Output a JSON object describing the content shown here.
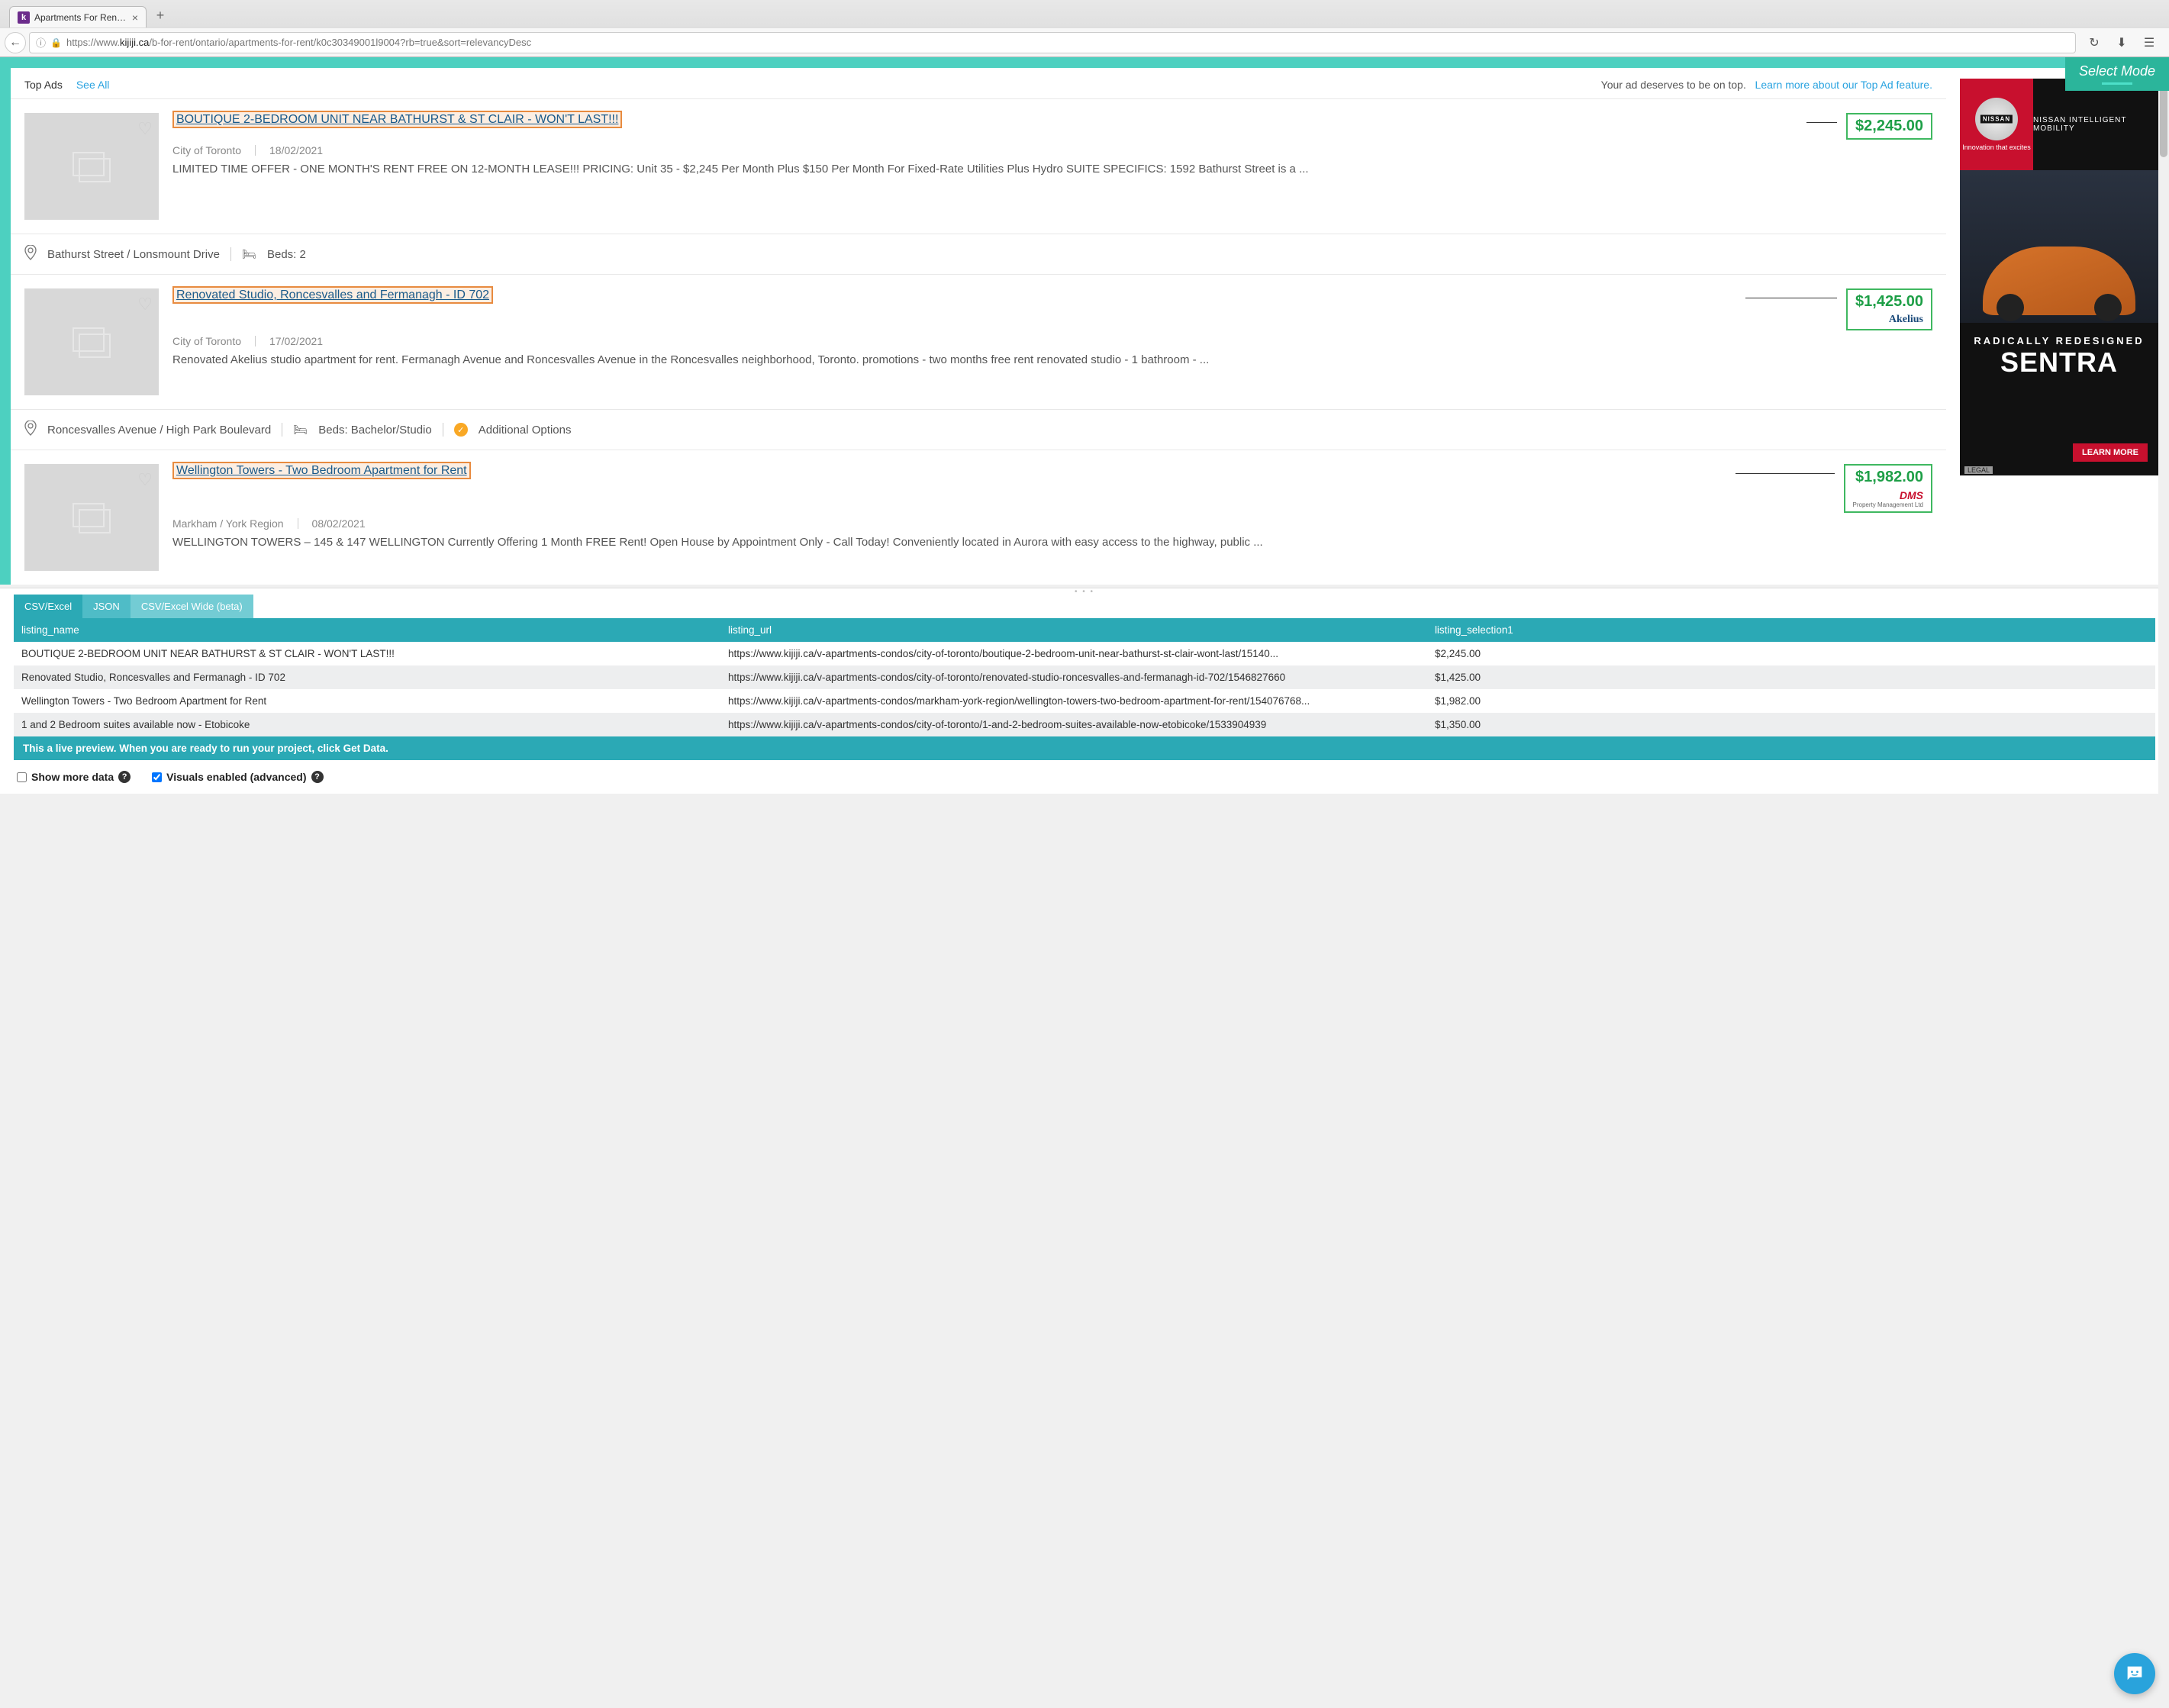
{
  "browser": {
    "tab_title": "Apartments For Rent | Kijiji in Ont…",
    "favicon_letter": "k",
    "url_prefix": "https://www.",
    "url_host": "kijiji.ca",
    "url_path": "/b-for-rent/ontario/apartments-for-rent/k0c30349001l9004?rb=true&sort=relevancyDesc"
  },
  "select_mode_label": "Select Mode",
  "top_ads": {
    "label": "Top Ads",
    "see_all": "See All",
    "right_text": "Your ad deserves to be on top.",
    "learn_more": "Learn more about our Top Ad feature."
  },
  "listings": [
    {
      "title": "BOUTIQUE 2-BEDROOM UNIT NEAR BATHURST & ST CLAIR - WON'T LAST!!!",
      "city": "City of Toronto",
      "date": "18/02/2021",
      "desc": "LIMITED TIME OFFER - ONE MONTH'S RENT FREE ON 12-MONTH LEASE!!! PRICING: Unit 35 - $2,245 Per Month Plus $150 Per Month For Fixed-Rate Utilities Plus Hydro SUITE SPECIFICS: 1592 Bathurst Street is a ...",
      "price": "$2,245.00",
      "price_logo": "",
      "footer_location": "Bathurst Street / Lonsmount Drive",
      "beds": "Beds: 2",
      "additional": ""
    },
    {
      "title": "Renovated Studio, Roncesvalles and Fermanagh - ID 702",
      "city": "City of Toronto",
      "date": "17/02/2021",
      "desc": "Renovated Akelius studio apartment for rent. Fermanagh Avenue and Roncesvalles Avenue in the Roncesvalles neighborhood, Toronto. promotions - two months free rent renovated studio - 1 bathroom - ...",
      "price": "$1,425.00",
      "price_logo": "Akelius",
      "footer_location": "Roncesvalles Avenue / High Park Boulevard",
      "beds": "Beds: Bachelor/Studio",
      "additional": "Additional Options"
    },
    {
      "title": "Wellington Towers - Two Bedroom Apartment for Rent",
      "city": "Markham / York Region",
      "date": "08/02/2021",
      "desc": "WELLINGTON TOWERS – 145 & 147 WELLINGTON Currently Offering 1 Month FREE Rent! Open House by Appointment Only - Call Today! Conveniently located in Aurora with easy access to the highway, public ...",
      "price": "$1,982.00",
      "price_logo": "DMS",
      "price_logo_subtitle": "Property Management Ltd",
      "footer_location": "",
      "beds": "",
      "additional": ""
    }
  ],
  "ad": {
    "brand": "NISSAN",
    "tagline": "Innovation that excites",
    "top_right": "NISSAN INTELLIGENT MOBILITY",
    "subtitle": "RADICALLY REDESIGNED",
    "title": "SENTRA",
    "cta": "LEARN MORE",
    "legal": "LEGAL"
  },
  "preview": {
    "tabs": {
      "csv": "CSV/Excel",
      "json": "JSON",
      "wide": "CSV/Excel Wide (beta)"
    },
    "headers": {
      "name": "listing_name",
      "url": "listing_url",
      "sel": "listing_selection1"
    },
    "rows": [
      {
        "name": "BOUTIQUE 2-BEDROOM UNIT NEAR BATHURST & ST CLAIR - WON'T LAST!!!",
        "url": "https://www.kijiji.ca/v-apartments-condos/city-of-toronto/boutique-2-bedroom-unit-near-bathurst-st-clair-wont-last/15140...",
        "sel": "$2,245.00"
      },
      {
        "name": "Renovated Studio, Roncesvalles and Fermanagh - ID 702",
        "url": "https://www.kijiji.ca/v-apartments-condos/city-of-toronto/renovated-studio-roncesvalles-and-fermanagh-id-702/1546827660",
        "sel": "$1,425.00"
      },
      {
        "name": "Wellington Towers - Two Bedroom Apartment for Rent",
        "url": "https://www.kijiji.ca/v-apartments-condos/markham-york-region/wellington-towers-two-bedroom-apartment-for-rent/154076768...",
        "sel": "$1,982.00"
      },
      {
        "name": "1 and 2 Bedroom suites available now - Etobicoke",
        "url": "https://www.kijiji.ca/v-apartments-condos/city-of-toronto/1-and-2-bedroom-suites-available-now-etobicoke/1533904939",
        "sel": "$1,350.00"
      }
    ],
    "live_bar": "This a live preview. When you are ready to run your project, click Get Data.",
    "show_more": "Show more data",
    "visuals": "Visuals enabled (advanced)"
  }
}
